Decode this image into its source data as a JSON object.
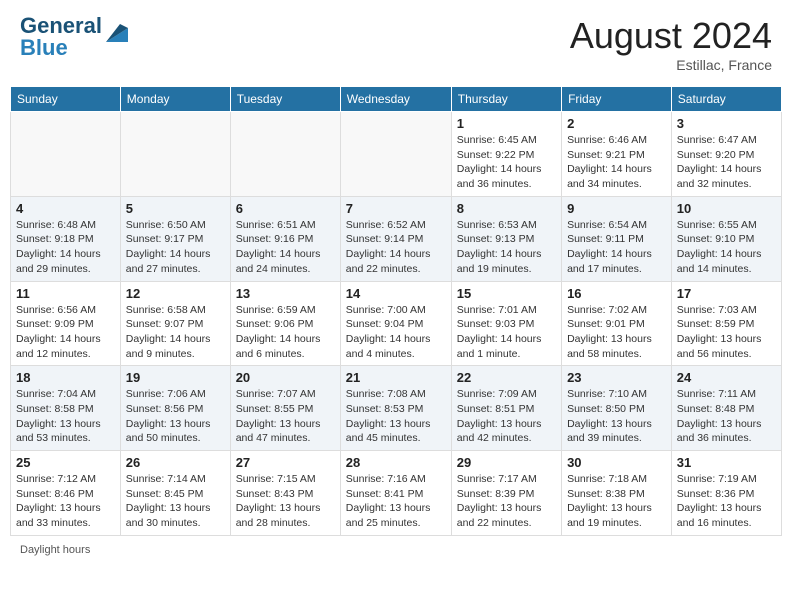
{
  "header": {
    "logo_text_general": "General",
    "logo_text_blue": "Blue",
    "month_year": "August 2024",
    "location": "Estillac, France"
  },
  "weekdays": [
    "Sunday",
    "Monday",
    "Tuesday",
    "Wednesday",
    "Thursday",
    "Friday",
    "Saturday"
  ],
  "footer": {
    "daylight_label": "Daylight hours"
  },
  "weeks": [
    [
      {
        "day": "",
        "sunrise": "",
        "sunset": "",
        "daylight": ""
      },
      {
        "day": "",
        "sunrise": "",
        "sunset": "",
        "daylight": ""
      },
      {
        "day": "",
        "sunrise": "",
        "sunset": "",
        "daylight": ""
      },
      {
        "day": "",
        "sunrise": "",
        "sunset": "",
        "daylight": ""
      },
      {
        "day": "1",
        "sunrise": "6:45 AM",
        "sunset": "9:22 PM",
        "daylight": "14 hours and 36 minutes."
      },
      {
        "day": "2",
        "sunrise": "6:46 AM",
        "sunset": "9:21 PM",
        "daylight": "14 hours and 34 minutes."
      },
      {
        "day": "3",
        "sunrise": "6:47 AM",
        "sunset": "9:20 PM",
        "daylight": "14 hours and 32 minutes."
      }
    ],
    [
      {
        "day": "4",
        "sunrise": "6:48 AM",
        "sunset": "9:18 PM",
        "daylight": "14 hours and 29 minutes."
      },
      {
        "day": "5",
        "sunrise": "6:50 AM",
        "sunset": "9:17 PM",
        "daylight": "14 hours and 27 minutes."
      },
      {
        "day": "6",
        "sunrise": "6:51 AM",
        "sunset": "9:16 PM",
        "daylight": "14 hours and 24 minutes."
      },
      {
        "day": "7",
        "sunrise": "6:52 AM",
        "sunset": "9:14 PM",
        "daylight": "14 hours and 22 minutes."
      },
      {
        "day": "8",
        "sunrise": "6:53 AM",
        "sunset": "9:13 PM",
        "daylight": "14 hours and 19 minutes."
      },
      {
        "day": "9",
        "sunrise": "6:54 AM",
        "sunset": "9:11 PM",
        "daylight": "14 hours and 17 minutes."
      },
      {
        "day": "10",
        "sunrise": "6:55 AM",
        "sunset": "9:10 PM",
        "daylight": "14 hours and 14 minutes."
      }
    ],
    [
      {
        "day": "11",
        "sunrise": "6:56 AM",
        "sunset": "9:09 PM",
        "daylight": "14 hours and 12 minutes."
      },
      {
        "day": "12",
        "sunrise": "6:58 AM",
        "sunset": "9:07 PM",
        "daylight": "14 hours and 9 minutes."
      },
      {
        "day": "13",
        "sunrise": "6:59 AM",
        "sunset": "9:06 PM",
        "daylight": "14 hours and 6 minutes."
      },
      {
        "day": "14",
        "sunrise": "7:00 AM",
        "sunset": "9:04 PM",
        "daylight": "14 hours and 4 minutes."
      },
      {
        "day": "15",
        "sunrise": "7:01 AM",
        "sunset": "9:03 PM",
        "daylight": "14 hours and 1 minute."
      },
      {
        "day": "16",
        "sunrise": "7:02 AM",
        "sunset": "9:01 PM",
        "daylight": "13 hours and 58 minutes."
      },
      {
        "day": "17",
        "sunrise": "7:03 AM",
        "sunset": "8:59 PM",
        "daylight": "13 hours and 56 minutes."
      }
    ],
    [
      {
        "day": "18",
        "sunrise": "7:04 AM",
        "sunset": "8:58 PM",
        "daylight": "13 hours and 53 minutes."
      },
      {
        "day": "19",
        "sunrise": "7:06 AM",
        "sunset": "8:56 PM",
        "daylight": "13 hours and 50 minutes."
      },
      {
        "day": "20",
        "sunrise": "7:07 AM",
        "sunset": "8:55 PM",
        "daylight": "13 hours and 47 minutes."
      },
      {
        "day": "21",
        "sunrise": "7:08 AM",
        "sunset": "8:53 PM",
        "daylight": "13 hours and 45 minutes."
      },
      {
        "day": "22",
        "sunrise": "7:09 AM",
        "sunset": "8:51 PM",
        "daylight": "13 hours and 42 minutes."
      },
      {
        "day": "23",
        "sunrise": "7:10 AM",
        "sunset": "8:50 PM",
        "daylight": "13 hours and 39 minutes."
      },
      {
        "day": "24",
        "sunrise": "7:11 AM",
        "sunset": "8:48 PM",
        "daylight": "13 hours and 36 minutes."
      }
    ],
    [
      {
        "day": "25",
        "sunrise": "7:12 AM",
        "sunset": "8:46 PM",
        "daylight": "13 hours and 33 minutes."
      },
      {
        "day": "26",
        "sunrise": "7:14 AM",
        "sunset": "8:45 PM",
        "daylight": "13 hours and 30 minutes."
      },
      {
        "day": "27",
        "sunrise": "7:15 AM",
        "sunset": "8:43 PM",
        "daylight": "13 hours and 28 minutes."
      },
      {
        "day": "28",
        "sunrise": "7:16 AM",
        "sunset": "8:41 PM",
        "daylight": "13 hours and 25 minutes."
      },
      {
        "day": "29",
        "sunrise": "7:17 AM",
        "sunset": "8:39 PM",
        "daylight": "13 hours and 22 minutes."
      },
      {
        "day": "30",
        "sunrise": "7:18 AM",
        "sunset": "8:38 PM",
        "daylight": "13 hours and 19 minutes."
      },
      {
        "day": "31",
        "sunrise": "7:19 AM",
        "sunset": "8:36 PM",
        "daylight": "13 hours and 16 minutes."
      }
    ]
  ]
}
